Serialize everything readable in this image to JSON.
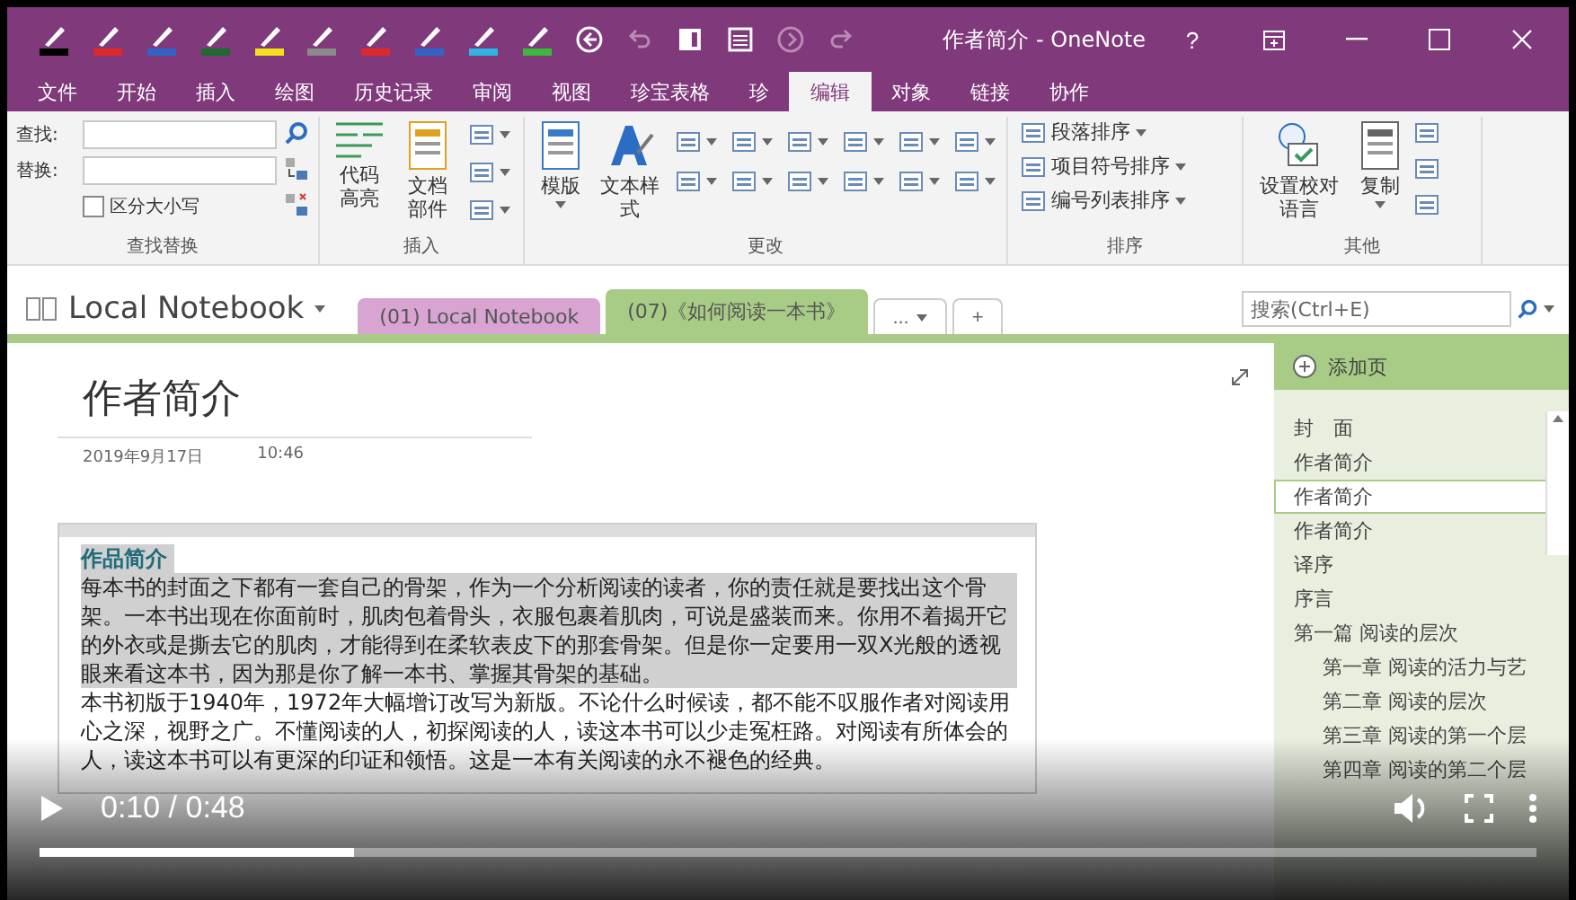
{
  "window": {
    "title": "作者简介 - OneNote",
    "help": "?"
  },
  "pens": [
    {
      "color": "#000000"
    },
    {
      "color": "#e0282a"
    },
    {
      "color": "#2f64c8"
    },
    {
      "color": "#1e6b32"
    },
    {
      "color": "#f4e01c"
    },
    {
      "color": "#8a8a8a"
    },
    {
      "color": "#e0282a"
    },
    {
      "color": "#2f64c8"
    },
    {
      "color": "#2fb4e8"
    },
    {
      "color": "#3cb83c"
    }
  ],
  "ribbon_tabs": [
    {
      "label": "文件",
      "selected": false
    },
    {
      "label": "开始",
      "selected": false
    },
    {
      "label": "插入",
      "selected": false
    },
    {
      "label": "绘图",
      "selected": false
    },
    {
      "label": "历史记录",
      "selected": false
    },
    {
      "label": "审阅",
      "selected": false
    },
    {
      "label": "视图",
      "selected": false
    },
    {
      "label": "珍宝表格",
      "selected": false
    },
    {
      "label": "珍",
      "selected": false
    },
    {
      "label": "编辑",
      "selected": true
    },
    {
      "label": "对象",
      "selected": false
    },
    {
      "label": "链接",
      "selected": false
    },
    {
      "label": "协作",
      "selected": false
    }
  ],
  "ribbon": {
    "find_replace": {
      "find_label": "查找:",
      "replace_label": "替换:",
      "match_case": {
        "label": "区分大小写",
        "checked": false
      },
      "group_label": "查找替换"
    },
    "insert": {
      "buttons": [
        "代码高亮",
        "文档部件"
      ],
      "group_label": "插入"
    },
    "change": {
      "buttons": [
        "模版",
        "文本样式"
      ],
      "group_label": "更改"
    },
    "sort": {
      "items": [
        "段落排序",
        "项目符号排序",
        "编号列表排序"
      ],
      "group_label": "排序"
    },
    "other": {
      "buttons": [
        "设置校对语言",
        "复制"
      ],
      "group_label": "其他"
    }
  },
  "notebook": {
    "name": "Local Notebook",
    "sections": [
      {
        "label": "(01) Local Notebook",
        "selected": false,
        "color": "#d8a4d2"
      },
      {
        "label": "(07)《如何阅读一本书》",
        "selected": true,
        "color": "#a8cb86"
      }
    ],
    "more": "...",
    "add": "+"
  },
  "search": {
    "placeholder": "搜索(Ctrl+E)"
  },
  "page": {
    "title": "作者简介",
    "date": "2019年9月17日",
    "time": "10:46",
    "outline": {
      "heading": {
        "text": "作品简介",
        "selected": true
      },
      "paragraphs": [
        {
          "text": "每本书的封面之下都有一套自己的骨架，作为一个分析阅读的读者，你的责任就是要找出这个骨架。一本书出现在你面前时，肌肉包着骨头，衣服包裹着肌肉，可说是盛装而来。你用不着揭开它的外衣或是撕去它的肌肉，才能得到在柔软表皮下的那套骨架。但是你一定要用一双X光般的透视眼来看这本书，因为那是你了解一本书、掌握其骨架的基础。",
          "selected": true
        },
        {
          "text": "本书初版于1940年，1972年大幅增订改写为新版。不论什么时候读，都不能不叹服作者对阅读用心之深，视野之广。不懂阅读的人，初探阅读的人，读这本书可以少走冤枉路。对阅读有所体会的人，读这本书可以有更深的印证和领悟。这是一本有关阅读的永不褪色的经典。",
          "selected": false
        }
      ]
    }
  },
  "page_list": {
    "add_page": "添加页",
    "pages": [
      {
        "label": "封　面",
        "selected": false
      },
      {
        "label": "作者简介",
        "selected": false
      },
      {
        "label": "作者简介",
        "selected": true
      },
      {
        "label": "作者简介",
        "selected": false
      },
      {
        "label": "译序",
        "selected": false
      },
      {
        "label": "序言",
        "selected": false
      },
      {
        "label": "第一篇 阅读的层次",
        "selected": false,
        "children": [
          {
            "label": "第一章 阅读的活力与艺",
            "selected": false
          },
          {
            "label": "第二章 阅读的层次",
            "selected": false
          },
          {
            "label": "第三章 阅读的第一个层",
            "selected": false
          },
          {
            "label": "第四章 阅读的第二个层",
            "selected": false
          }
        ]
      }
    ]
  },
  "video": {
    "time": "0:10 / 0:48",
    "level": 0.21
  }
}
